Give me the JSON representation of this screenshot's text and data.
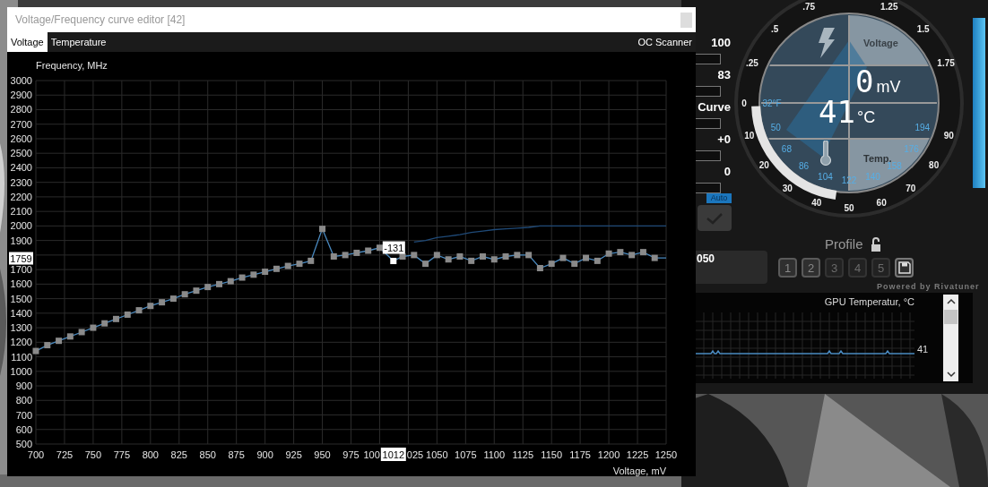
{
  "window": {
    "title": "Voltage/Frequency curve editor [42]"
  },
  "tabs": [
    {
      "label": "Voltage",
      "selected": true
    },
    {
      "label": "Temperature",
      "selected": false
    }
  ],
  "oc_scanner": {
    "label": "OC Scanner"
  },
  "chart_data": {
    "type": "line",
    "xlabel": "Voltage, mV",
    "ylabel": "Frequency, MHz",
    "xlim": [
      700,
      1250
    ],
    "ylim": [
      500,
      3000
    ],
    "x": [
      700,
      710,
      720,
      730,
      740,
      750,
      760,
      770,
      780,
      790,
      800,
      810,
      820,
      830,
      840,
      850,
      860,
      870,
      880,
      890,
      900,
      910,
      920,
      930,
      940,
      950,
      960,
      970,
      980,
      990,
      1000,
      1012,
      1020,
      1030,
      1040,
      1050,
      1060,
      1070,
      1080,
      1090,
      1100,
      1110,
      1120,
      1130,
      1140,
      1150,
      1160,
      1170,
      1180,
      1190,
      1200,
      1210,
      1220,
      1230,
      1240,
      1250
    ],
    "grid": true,
    "series": [
      {
        "color": "#4a8ac0",
        "marker": "square",
        "values": [
          1140,
          1180,
          1210,
          1240,
          1270,
          1300,
          1330,
          1360,
          1390,
          1420,
          1450,
          1475,
          1500,
          1530,
          1555,
          1580,
          1600,
          1620,
          1645,
          1665,
          1685,
          1705,
          1725,
          1740,
          1760,
          1980,
          1790,
          1800,
          1815,
          1830,
          1850,
          1759,
          1790,
          1800,
          1740,
          1800,
          1770,
          1790,
          1760,
          1790,
          1770,
          1790,
          1800,
          1800,
          1710,
          1740,
          1780,
          1740,
          1780,
          1760,
          1810,
          1820,
          1800,
          1820,
          1780,
          1780
        ]
      },
      {
        "color": "#1f4a78",
        "values": [
          null,
          null,
          null,
          null,
          null,
          null,
          null,
          null,
          null,
          null,
          null,
          null,
          null,
          null,
          null,
          null,
          null,
          null,
          null,
          null,
          null,
          null,
          null,
          null,
          null,
          null,
          null,
          null,
          null,
          null,
          null,
          null,
          null,
          1890,
          1900,
          1920,
          1930,
          1940,
          1955,
          1965,
          1975,
          1980,
          1985,
          1990,
          2000,
          2000,
          2000,
          2000,
          2000,
          2000,
          2000,
          2000,
          2000,
          2000,
          2000,
          2000
        ]
      }
    ],
    "xticks": [
      700,
      725,
      750,
      775,
      800,
      825,
      850,
      875,
      900,
      925,
      950,
      975,
      1050,
      1075,
      1100,
      1125,
      1150,
      1175,
      1200,
      1225,
      1250
    ],
    "yticks": [
      500,
      600,
      700,
      800,
      900,
      1000,
      1100,
      1200,
      1300,
      1400,
      1500,
      1600,
      1700,
      1900,
      2000,
      2100,
      2200,
      2300,
      2400,
      2500,
      2600,
      2700,
      2800,
      2900,
      3000
    ],
    "annotations": [
      {
        "x": 1012,
        "y": 1759,
        "text": "-131"
      }
    ]
  },
  "cursor": {
    "voltage": "1012",
    "frequency": "1759",
    "covered_x_ticks": [
      "100",
      "025"
    ]
  },
  "background_app": {
    "sliders": [
      {
        "value": "100"
      },
      {
        "value": "83"
      },
      {
        "value": "Curve"
      },
      {
        "value": "+0"
      },
      {
        "value": "0"
      }
    ],
    "auto": {
      "label": "Auto",
      "on": true
    },
    "gpu_field": {
      "value": "050"
    },
    "gauge": {
      "voltage_scale": [
        ".25",
        ".5",
        ".75",
        "1.25",
        "1.5",
        "1.75"
      ],
      "temp_scale": [
        "0",
        "10",
        "20",
        "30",
        "40",
        "50",
        "60",
        "70",
        "80",
        "90"
      ],
      "fahrenheit_scale": [
        "32°F",
        "50",
        "68",
        "86",
        "104",
        "122",
        "140",
        "158",
        "176",
        "194"
      ],
      "voltage_label": "Voltage",
      "voltage_value": "0",
      "voltage_unit": "mV",
      "temp_value": "41",
      "temp_unit": "°C",
      "temp_label": "Temp."
    },
    "profile": {
      "label": "Profile",
      "locked": false,
      "slots": [
        {
          "label": "1",
          "disabled": false
        },
        {
          "label": "2",
          "disabled": false
        },
        {
          "label": "3",
          "disabled": true
        },
        {
          "label": "4",
          "disabled": true
        },
        {
          "label": "5",
          "disabled": true
        }
      ]
    },
    "powered_by": "Powered by Rivatuner",
    "monitor": {
      "title": "GPU Temperatur, °C",
      "value": "41"
    }
  }
}
